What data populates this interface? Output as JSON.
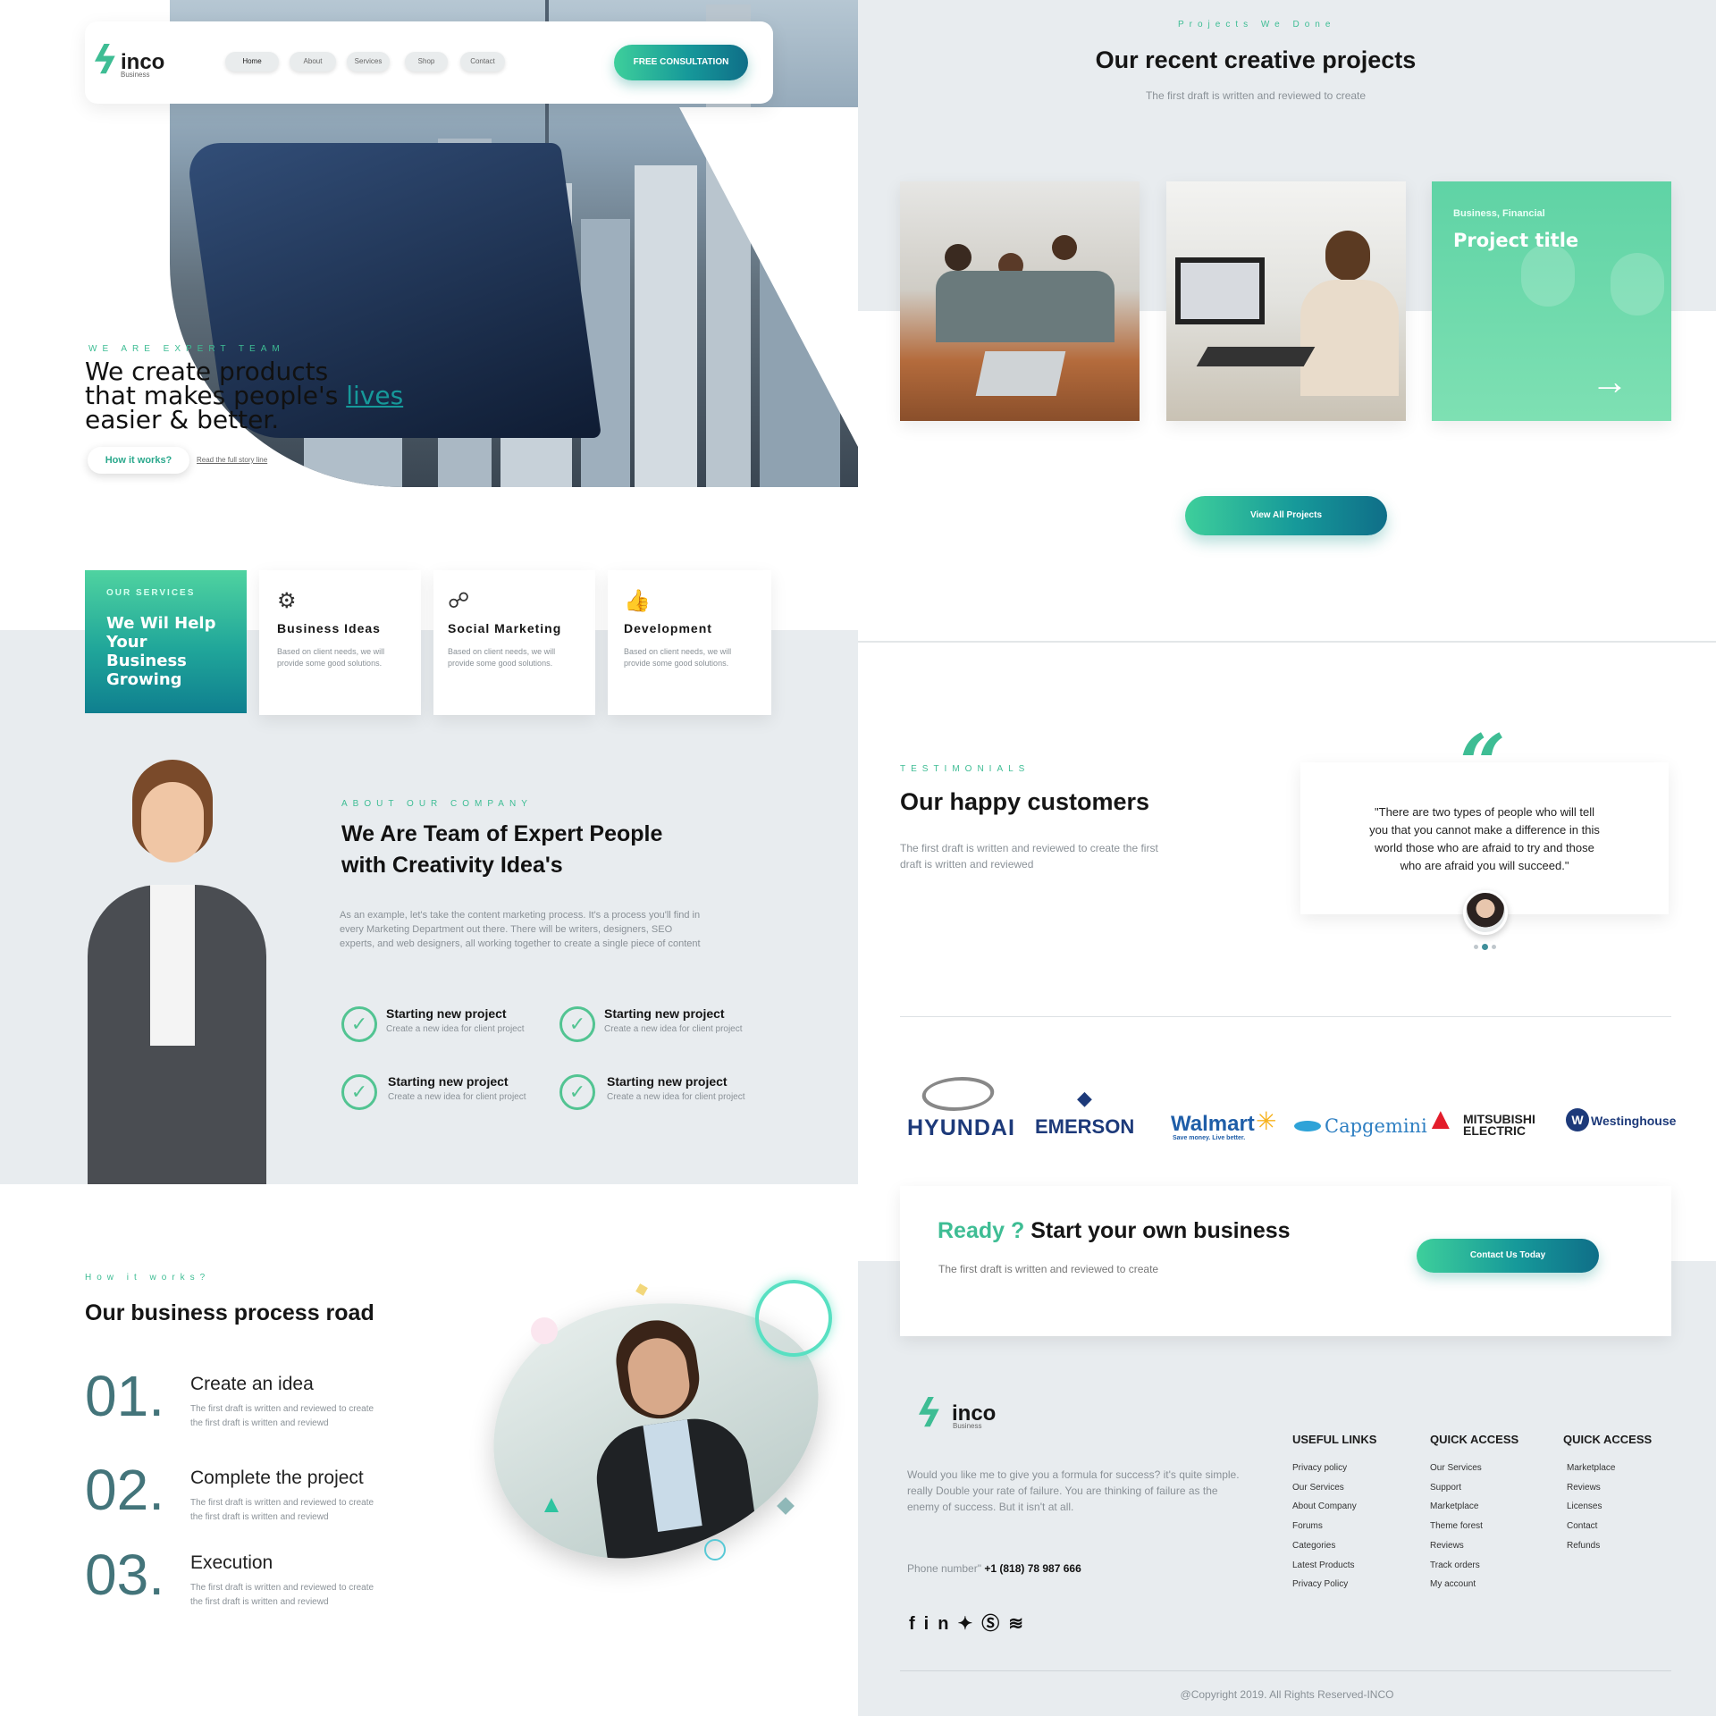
{
  "colors": {
    "accent": "#3ebd94",
    "teal": "#16999a",
    "dark": "#0f6e88",
    "section_bg": "#e8ecef"
  },
  "brand": {
    "name": "inco",
    "sub": "Business"
  },
  "nav": {
    "items": [
      "Home",
      "About",
      "Services",
      "Shop",
      "Contact"
    ],
    "cta": "FREE CONSULTATION"
  },
  "hero": {
    "eyebrow": "WE ARE EXPERT TEAM",
    "title_line1": "We create products",
    "title_line2_pre": "that makes people's ",
    "title_line2_link": "lives",
    "title_line3": "easier & better.",
    "btn": "How it works?",
    "link": "Read the full story line"
  },
  "services": {
    "eyebrow": "OUR SERVICES",
    "title": "We Wil Help Your Business Growing",
    "items": [
      {
        "icon": "ideas-icon",
        "title": "Business Ideas",
        "text": "Based on client needs, we will provide some good solutions."
      },
      {
        "icon": "social-icon",
        "title": "Social Marketing",
        "text": "Based on client needs, we will provide some good solutions."
      },
      {
        "icon": "thumbs-up-icon",
        "title": "Development",
        "text": "Based on client needs, we will provide some good solutions."
      }
    ]
  },
  "about": {
    "eyebrow": "ABOUT OUR COMPANY",
    "title_line1": "We Are Team of Expert People",
    "title_line2": "with Creativity Idea's",
    "body": "As an example, let's take the content marketing process. It's a process you'll find in every Marketing Department out there. There will be writers, designers, SEO experts, and web designers, all working together to create a single piece of content",
    "features": [
      {
        "title": "Starting new project",
        "sub": "Create a new idea for client project"
      },
      {
        "title": "Starting new project",
        "sub": "Create a new idea for client project"
      },
      {
        "title": "Starting new project",
        "sub": "Create a new idea for client project"
      },
      {
        "title": "Starting new project",
        "sub": "Create a new idea for client project"
      }
    ]
  },
  "process": {
    "eyebrow": "How it works?",
    "title": "Our business process road",
    "steps": [
      {
        "num": "01.",
        "title": "Create an idea",
        "l1": "The first draft is written and reviewed to create",
        "l2": "the first draft is written and reviewd"
      },
      {
        "num": "02.",
        "title": "Complete the project",
        "l1": "The first draft is written and reviewed to create",
        "l2": "the first draft is written and reviewd"
      },
      {
        "num": "03.",
        "title": "Execution",
        "l1": "The first draft is written and reviewed to create",
        "l2": "the first draft is written and reviewd"
      }
    ]
  },
  "projects": {
    "eyebrow": "Projects We Done",
    "title": "Our recent creative projects",
    "sub": "The first draft is written and reviewed to create",
    "overlay_cat": "Business, Financial",
    "overlay_title": "Project title",
    "btn": "View All Projects"
  },
  "testimonials": {
    "eyebrow": "TESTIMONIALS",
    "title": "Our happy customers",
    "sub_l1": "The first draft is written and reviewed to create the first",
    "sub_l2": "draft is written and reviewed",
    "quote_l1": "\"There are two types of people who will tell",
    "quote_l2": "you that you cannot make a difference in this",
    "quote_l3": "world those who are afraid to try and those",
    "quote_l4": "who are afraid you will succeed.\""
  },
  "clients": [
    "HYUNDAI",
    "EMERSON",
    "Walmart",
    "Capgemini",
    "MITSUBISHI ELECTRIC",
    "Westinghouse"
  ],
  "clients_extra": {
    "walmart_tag": "Save money. Live better."
  },
  "cta": {
    "ready": "Ready ?",
    "title": " Start your own business",
    "sub": "The first draft is written and reviewed to create",
    "btn": "Contact Us Today"
  },
  "footer": {
    "about_l1": "Would you like me to give you a formula for success? it's quite simple.",
    "about_l2": "really Double your rate of failure. You are thinking of failure as the",
    "about_l3": "enemy of success. But it isn't at all.",
    "phone_label": "Phone number\"",
    "phone": "+1 (818) 78 987 666",
    "col1": {
      "title": "USEFUL LINKS",
      "links": [
        "Privacy policy",
        "Our Services",
        "About Company",
        "Forums",
        "Categories",
        "Latest Products",
        "Privacy Policy"
      ]
    },
    "col2": {
      "title": "QUICK ACCESS",
      "links": [
        "Our Services",
        "Support",
        "Marketplace",
        "Theme forest",
        "Reviews",
        "Track orders",
        "My account"
      ]
    },
    "col3": {
      "title": "QUICK ACCESS",
      "links": [
        "Marketplace",
        "Reviews",
        "Licenses",
        "Contact",
        "Refunds"
      ]
    },
    "social": [
      "facebook-icon",
      "linkedin-icon",
      "twitter-icon",
      "skype-icon",
      "rss-icon"
    ],
    "copyright": "@Copyright 2019. All Rights Reserved-INCO"
  }
}
